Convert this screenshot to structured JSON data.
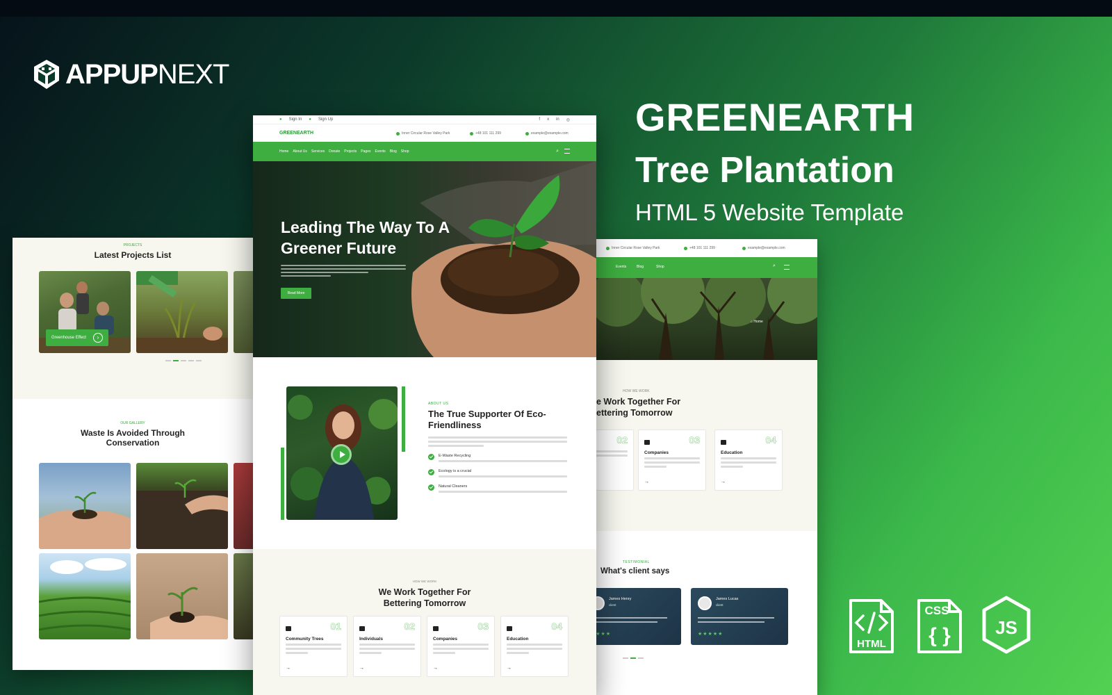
{
  "brand": {
    "bold": "APPUP",
    "light": "NEXT"
  },
  "headline": {
    "title": "GREENEARTH",
    "subtitle": "Tree Plantation",
    "tagline": "HTML 5 Website Template"
  },
  "colors": {
    "accent": "#3dae3f",
    "dark": "#06121a"
  },
  "left_mockup": {
    "projects_eyebrow": "PROJECTS",
    "projects_title": "Latest Projects List",
    "project_tag": "Greenhouse Effect",
    "gallery_eyebrow": "OUR GALLERY",
    "gallery_title_line1": "Waste Is Avoided Through",
    "gallery_title_line2": "Conservation"
  },
  "center_mockup": {
    "top_links": [
      "Sign In",
      "Sign Up"
    ],
    "logo": "GREENEARTH",
    "address": "Inner Circular Rose Valley Park",
    "phone": "+48 101 111 299",
    "email": "example@example.com",
    "nav": [
      "Home",
      "About Us",
      "Services",
      "Donate",
      "Projects",
      "Pages",
      "Events",
      "Blog",
      "Shop"
    ],
    "hero_title_line1": "Leading The Way To A",
    "hero_title_line2": "Greener Future",
    "hero_button": "Read More",
    "about_eyebrow": "ABOUT US",
    "about_title_line1": "The True Supporter Of Eco-",
    "about_title_line2": "Friendliness",
    "about_points": [
      "E-Waste Recycling",
      "Ecology is a crucial",
      "Natural Cleaners"
    ],
    "work_eyebrow": "HOW WE WORK",
    "work_title_line1": "We Work Together For",
    "work_title_line2": "Bettering Tomorrow",
    "cards": [
      {
        "num": "01",
        "title": "Community Trees"
      },
      {
        "num": "02",
        "title": "Individuals"
      },
      {
        "num": "03",
        "title": "Companies"
      },
      {
        "num": "04",
        "title": "Education"
      }
    ]
  },
  "right_mockup": {
    "address": "Inner Circular Rose Valley Park",
    "phone": "+48 101 111 299",
    "email": "example@example.com",
    "nav": [
      "Events",
      "Blog",
      "Shop"
    ],
    "breadcrumb": "Home",
    "work_eyebrow": "HOW WE WORK",
    "work_title_line1": "e Work Together For",
    "work_title_line2": "ettering Tomorrow",
    "cards": [
      {
        "num": "02",
        "title": ""
      },
      {
        "num": "03",
        "title": "Companies"
      },
      {
        "num": "04",
        "title": "Education"
      }
    ],
    "testi_eyebrow": "TESTIMONIAL",
    "testi_title": "What's client says",
    "testimonials": [
      {
        "name": "James Henry",
        "role": "client",
        "stars": "★★★★"
      },
      {
        "name": "James Lucas",
        "role": "client",
        "stars": "★★★★★"
      }
    ]
  },
  "tech": {
    "html": "HTML",
    "css": "CSS",
    "js": "JS"
  }
}
